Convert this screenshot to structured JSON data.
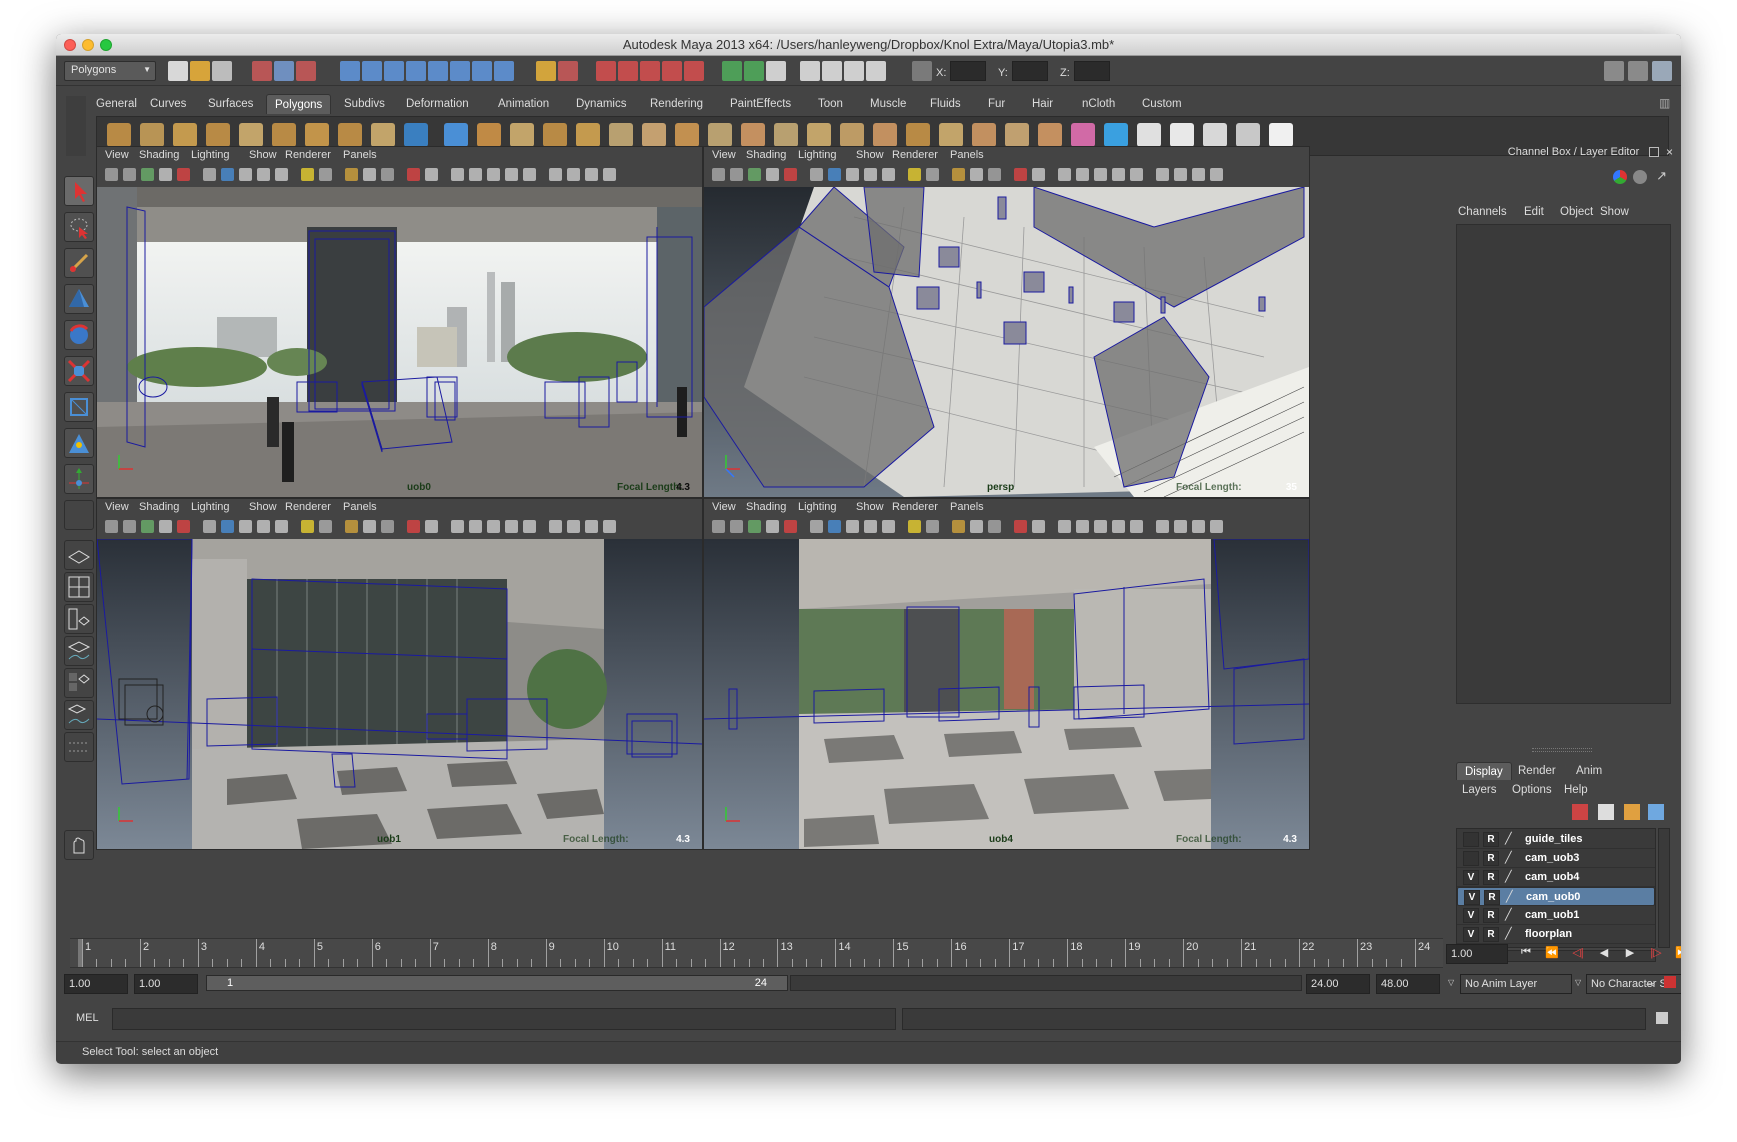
{
  "window": {
    "title": "Autodesk Maya 2013 x64: /Users/hanleyweng/Dropbox/Knol Extra/Maya/Utopia3.mb*"
  },
  "status_line": {
    "mode": "Polygons",
    "x_label": "X:",
    "y_label": "Y:",
    "z_label": "Z:"
  },
  "shelf_tabs": [
    "General",
    "Curves",
    "Surfaces",
    "Polygons",
    "Subdivs",
    "Deformation",
    "Animation",
    "Dynamics",
    "Rendering",
    "PaintEffects",
    "Toon",
    "Muscle",
    "Fluids",
    "Fur",
    "Hair",
    "nCloth",
    "Custom"
  ],
  "shelf_active": "Polygons",
  "panel_menu": {
    "view": "View",
    "shading": "Shading",
    "lighting": "Lighting",
    "show": "Show",
    "renderer": "Renderer",
    "panels": "Panels"
  },
  "panes": {
    "top_left": {
      "camera": "uob0",
      "focal_label": "Focal Length:",
      "focal_value": "4.3"
    },
    "top_right": {
      "camera": "persp",
      "focal_label": "Focal Length:",
      "focal_value": "35"
    },
    "bottom_left": {
      "camera": "uob1",
      "focal_label": "Focal Length:",
      "focal_value": "4.3"
    },
    "bottom_right": {
      "camera": "uob4",
      "focal_label": "Focal Length:",
      "focal_value": "4.3"
    }
  },
  "channel_box": {
    "title": "Channel Box / Layer Editor",
    "menu": [
      "Channels",
      "Edit",
      "Object",
      "Show"
    ],
    "layer_tabs": [
      "Display",
      "Render",
      "Anim"
    ],
    "layer_menu": [
      "Layers",
      "Options",
      "Help"
    ],
    "layers": [
      {
        "v": "",
        "r": "R",
        "name": "guide_tiles",
        "selected": false
      },
      {
        "v": "",
        "r": "R",
        "name": "cam_uob3",
        "selected": false
      },
      {
        "v": "V",
        "r": "R",
        "name": "cam_uob4",
        "selected": false
      },
      {
        "v": "V",
        "r": "R",
        "name": "cam_uob0",
        "selected": true
      },
      {
        "v": "V",
        "r": "R",
        "name": "cam_uob1",
        "selected": false
      },
      {
        "v": "V",
        "r": "R",
        "name": "floorplan",
        "selected": false
      }
    ]
  },
  "time_slider": {
    "ticks": [
      "1",
      "2",
      "3",
      "4",
      "5",
      "6",
      "7",
      "8",
      "9",
      "10",
      "11",
      "12",
      "13",
      "14",
      "15",
      "16",
      "17",
      "18",
      "19",
      "20",
      "21",
      "22",
      "23",
      "24"
    ],
    "current_time": "1.00"
  },
  "range": {
    "start": "1.00",
    "start_inner": "1.00",
    "range_left": "1",
    "range_right": "24",
    "end_inner": "24.00",
    "end": "48.00",
    "anim_layer": "No Anim Layer",
    "character_set": "No Character Set"
  },
  "command_line": {
    "label": "MEL"
  },
  "help_line": {
    "text": "Select Tool: select an object"
  },
  "colors": {
    "accent": "#5b7ea3",
    "wireframe": "#1a1aa0",
    "maya_bg": "#444444"
  }
}
